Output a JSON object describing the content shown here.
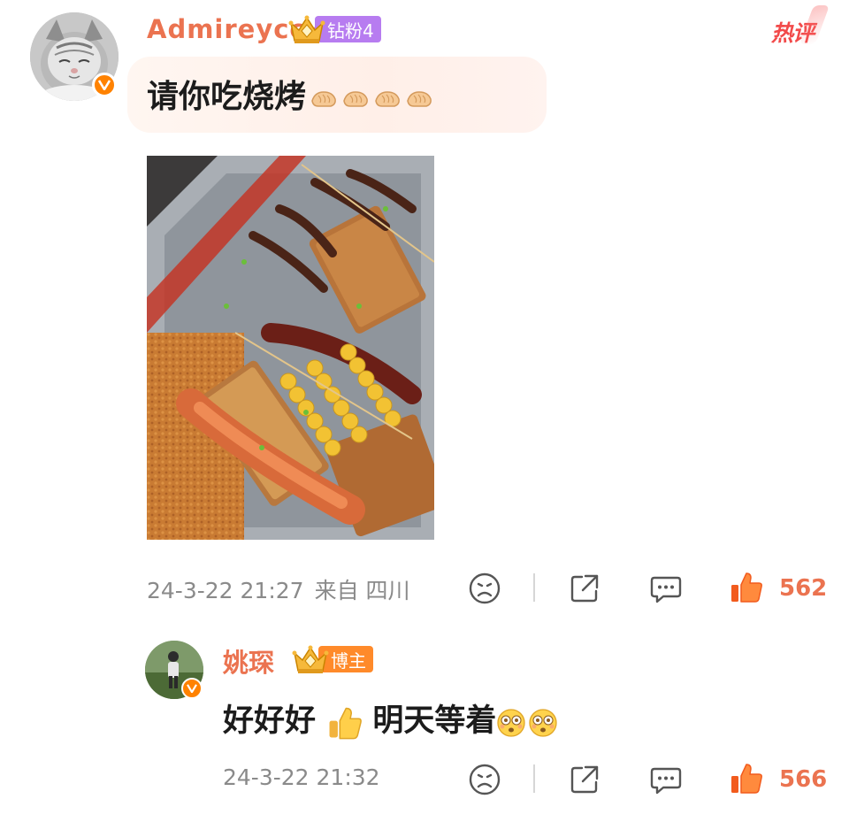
{
  "comment": {
    "username": "Admireyccx",
    "fan_badge": "钻粉4",
    "hot_tag": "热评",
    "text": "请你吃烧烤",
    "hand_icons": [
      "clapping-hand-icon",
      "clapping-hand-icon",
      "clapping-hand-icon",
      "clapping-hand-icon"
    ],
    "timestamp": "24-3-22 21:27",
    "location": "来自 四川",
    "like_count": "562"
  },
  "reply": {
    "username": "姚琛",
    "fan_badge": "博主",
    "text_before": "好好好",
    "text_after": "明天等着",
    "timestamp": "24-3-22 21:32",
    "like_count": "566"
  },
  "colors": {
    "accent": "#eb7350",
    "verified": "#ff8200",
    "fan_badge_purple": "#b77cf0",
    "fan_badge_orange": "#ff8a2a",
    "hot_red": "#f24a4a",
    "meta_gray": "#8a8a8a"
  }
}
